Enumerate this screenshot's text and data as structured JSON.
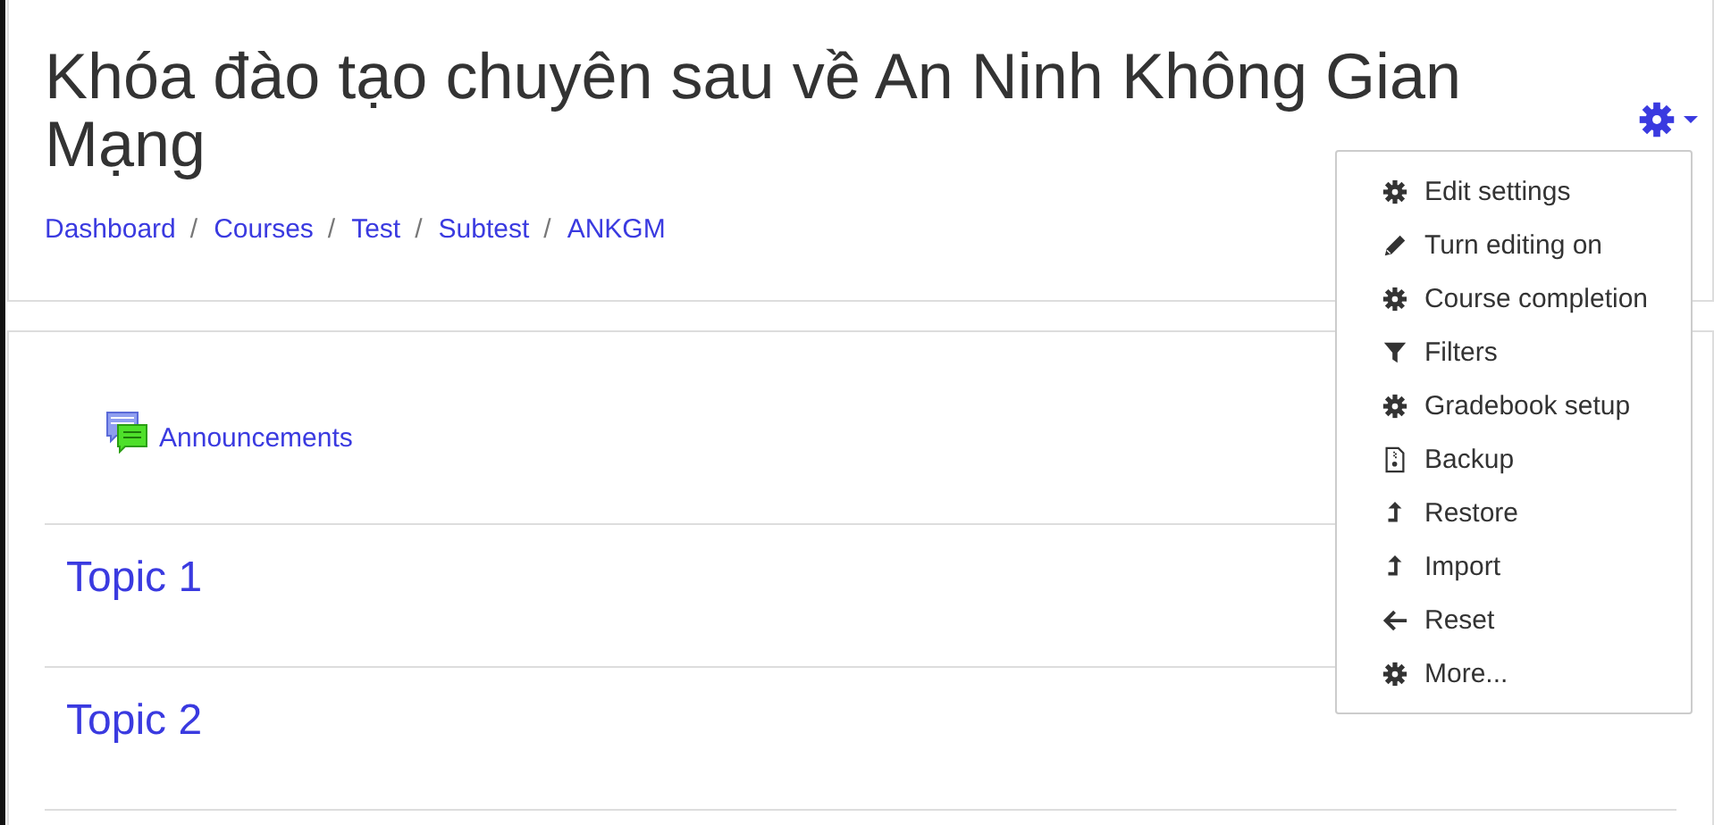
{
  "header": {
    "title": "Khóa đào tạo chuyên sau về An Ninh Không Gian Mạng",
    "breadcrumb": [
      {
        "label": "Dashboard"
      },
      {
        "label": "Courses"
      },
      {
        "label": "Test"
      },
      {
        "label": "Subtest"
      },
      {
        "label": "ANKGM"
      }
    ],
    "separator": "/"
  },
  "actions_menu": {
    "items": [
      {
        "label": "Edit settings",
        "kind": "gear"
      },
      {
        "label": "Turn editing on",
        "kind": "pencil"
      },
      {
        "label": "Course completion",
        "kind": "gear"
      },
      {
        "label": "Filters",
        "kind": "filter"
      },
      {
        "label": "Gradebook setup",
        "kind": "gear"
      },
      {
        "label": "Backup",
        "kind": "file"
      },
      {
        "label": "Restore",
        "kind": "upload"
      },
      {
        "label": "Import",
        "kind": "upload"
      },
      {
        "label": "Reset",
        "kind": "back"
      },
      {
        "label": "More...",
        "kind": "gear"
      }
    ]
  },
  "course": {
    "activities": [
      {
        "label": "Announcements"
      }
    ],
    "sections": [
      {
        "title": "Topic 1"
      },
      {
        "title": "Topic 2"
      }
    ]
  }
}
